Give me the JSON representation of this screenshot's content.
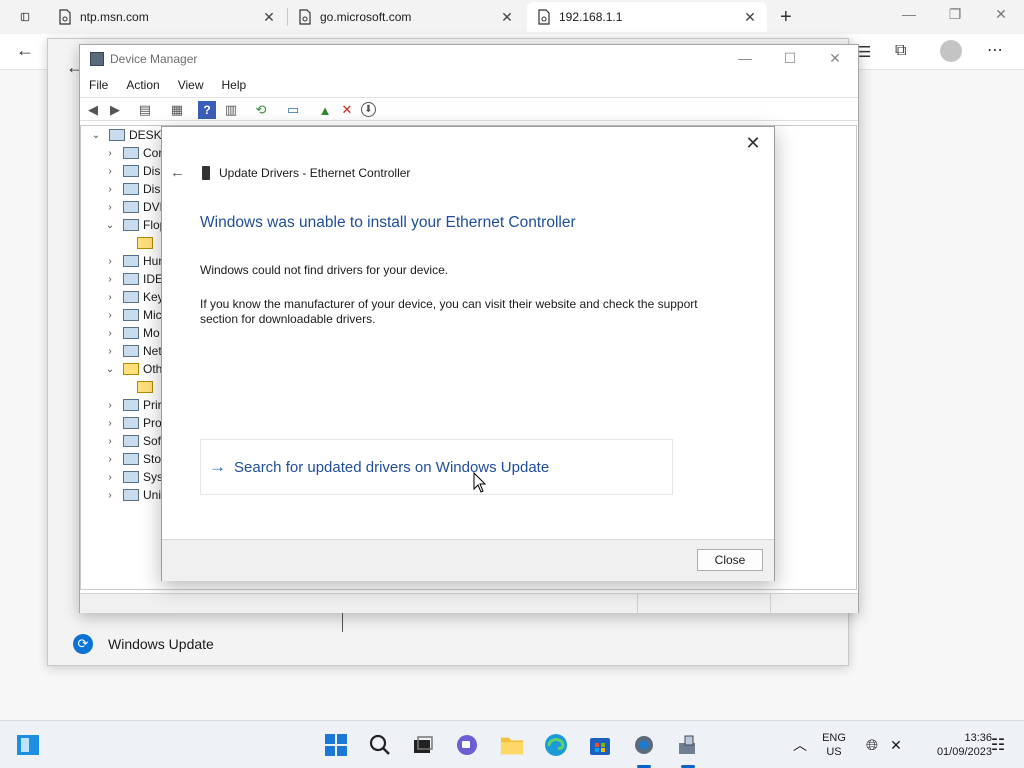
{
  "browser": {
    "tabs": [
      {
        "label": "ntp.msn.com"
      },
      {
        "label": "go.microsoft.com"
      },
      {
        "label": "192.168.1.1"
      }
    ],
    "new_tab_symbol": "+"
  },
  "settings_bg": {
    "windows_update_label": "Windows Update"
  },
  "device_manager": {
    "title": "Device Manager",
    "menu": [
      "File",
      "Action",
      "View",
      "Help"
    ],
    "tree": [
      {
        "label": "DESKTO",
        "expanded": true
      },
      {
        "label": "Cor"
      },
      {
        "label": "Disk"
      },
      {
        "label": "Disp"
      },
      {
        "label": "DVD"
      },
      {
        "label": "Flop",
        "expanded": true
      },
      {
        "label": ""
      },
      {
        "label": "Hun"
      },
      {
        "label": "IDE"
      },
      {
        "label": "Key"
      },
      {
        "label": "Mic"
      },
      {
        "label": "Mo"
      },
      {
        "label": "Net"
      },
      {
        "label": "Oth",
        "expanded": true
      },
      {
        "label": ""
      },
      {
        "label": "Prir"
      },
      {
        "label": "Pro"
      },
      {
        "label": "Soft"
      },
      {
        "label": "Stor"
      },
      {
        "label": "Syst"
      },
      {
        "label": "Uni"
      }
    ]
  },
  "dialog": {
    "title": "Update Drivers - Ethernet Controller",
    "heading": "Windows was unable to install your Ethernet Controller",
    "para1": "Windows could not find drivers for your device.",
    "para2": "If you know the manufacturer of your device, you can visit their website and check the support section for downloadable drivers.",
    "link_label": "Search for updated drivers on Windows Update",
    "close_label": "Close"
  },
  "taskbar": {
    "lang_line1": "ENG",
    "lang_line2": "US",
    "time": "13:36",
    "date": "01/09/2023"
  },
  "colors": {
    "heading_blue": "#1f4e9a",
    "link_arrow": "#1f62c5"
  }
}
